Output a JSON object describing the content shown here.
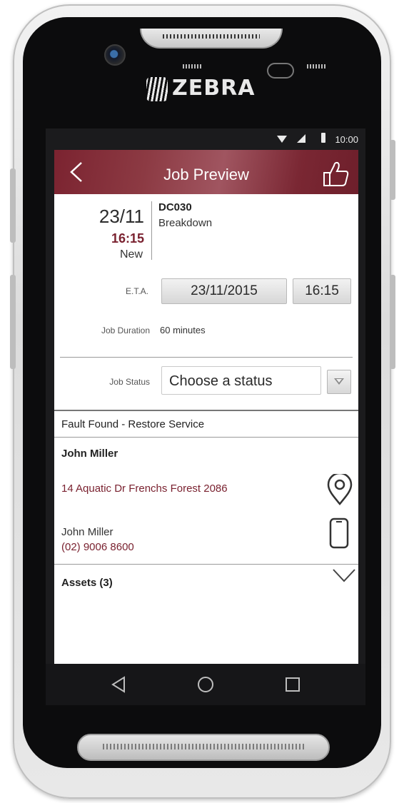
{
  "device": {
    "brand": "ZEBRA"
  },
  "statusbar": {
    "time": "10:00"
  },
  "appbar": {
    "title": "Job Preview"
  },
  "job": {
    "date": "23/11",
    "time": "16:15",
    "status": "New",
    "code": "DC030",
    "type": "Breakdown"
  },
  "eta": {
    "label": "E.T.A.",
    "date": "23/11/2015",
    "time": "16:15"
  },
  "duration": {
    "label": "Job Duration",
    "value": "60 minutes"
  },
  "job_status": {
    "label": "Job Status",
    "selected": "Choose a status"
  },
  "fault": "Fault Found - Restore Service",
  "customer": {
    "name": "John Miller",
    "address": "14 Aquatic Dr  Frenchs Forest 2086",
    "contact_name": "John Miller",
    "phone": "(02) 9006 8600"
  },
  "assets": {
    "label": "Assets (3)"
  },
  "colors": {
    "accent": "#7a2230",
    "appbar": "#8c3a43"
  },
  "icons": [
    "back-icon",
    "thumbs-up-icon",
    "location-pin-icon",
    "mobile-phone-icon",
    "chevron-down-icon",
    "nav-back-icon",
    "nav-home-icon",
    "nav-recents-icon"
  ]
}
